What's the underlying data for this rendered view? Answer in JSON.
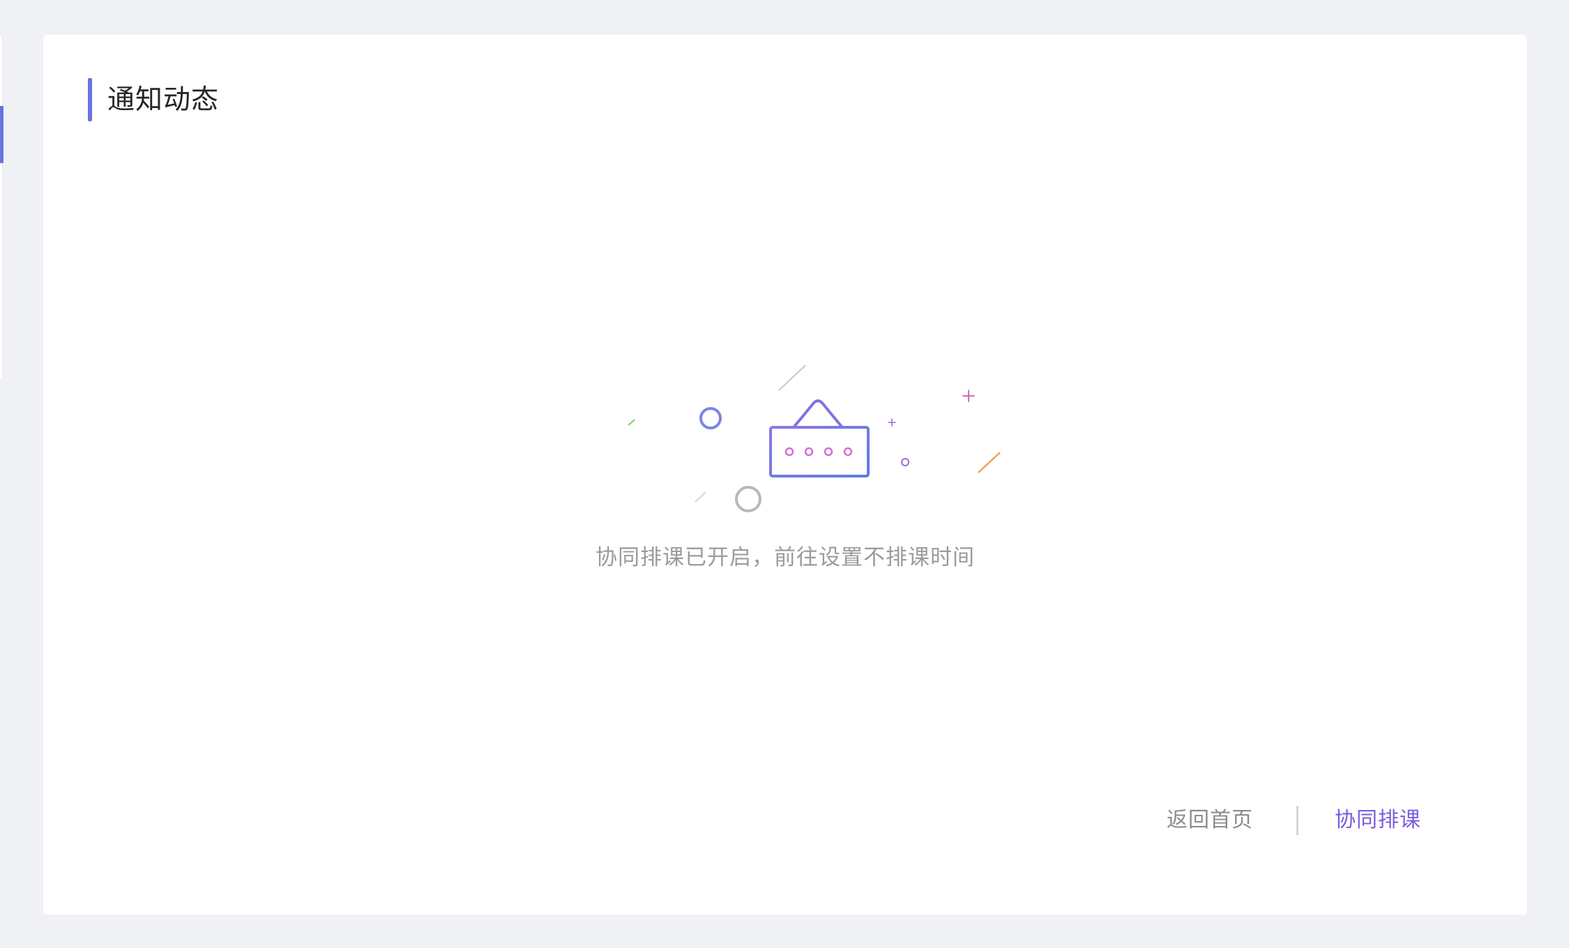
{
  "notice_section": {
    "title": "通知动态"
  },
  "empty_state": {
    "message": "协同排课已开启，前往设置不排课时间",
    "illustration_icon": "empty-calendar-icon"
  },
  "actions": {
    "home_label": "返回首页",
    "schedule_label": "协同排课"
  },
  "colors": {
    "accent": "#6b72e0",
    "link": "#7a5bdc",
    "muted_text": "#9b9b9b",
    "background": "#f0f1f5"
  }
}
